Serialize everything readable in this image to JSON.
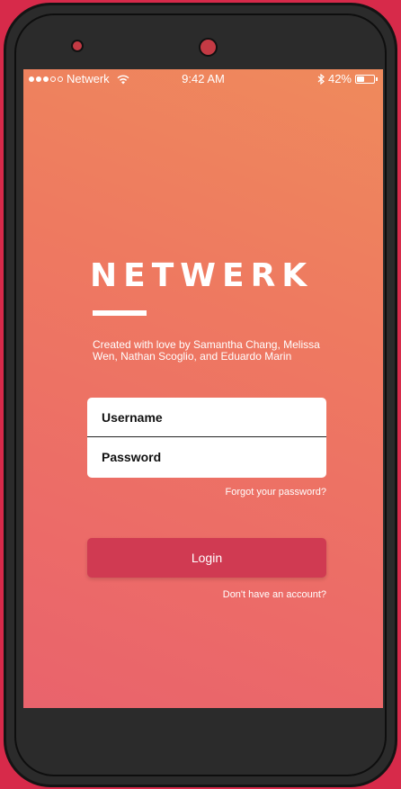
{
  "status_bar": {
    "signal_dots_filled": 3,
    "signal_dots_total": 5,
    "carrier": "Netwerk",
    "time": "9:42 AM",
    "battery_percent": "42%",
    "battery_level": 0.42
  },
  "app": {
    "logo": "NETWERK",
    "credits": "Created with love by Samantha Chang, Melissa Wen, Nathan Scoglio, and Eduardo Marin"
  },
  "form": {
    "username_placeholder": "Username",
    "password_placeholder": "Password",
    "forgot_link": "Forgot your password?",
    "login_button": "Login",
    "signup_link": "Don't have an account?"
  },
  "colors": {
    "background": "#d72a4a",
    "gradient_top": "#ef8a5c",
    "gradient_bottom": "#e9636c",
    "login_button": "#d03a52"
  },
  "icons": [
    "wifi-icon",
    "bluetooth-icon",
    "battery-icon"
  ]
}
